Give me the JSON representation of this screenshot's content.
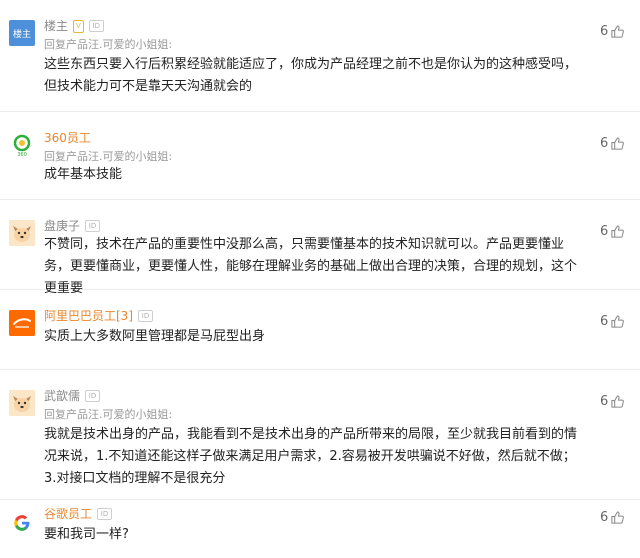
{
  "comments": [
    {
      "avatar_text": "楼主",
      "username": "楼主",
      "badge_v": "V",
      "id_tag": "ID",
      "reply_to": "回复产品汪.可爱的小姐姐:",
      "body": "这些东西只要入行后积累经验就能适应了，你成为产品经理之前不也是你认为的这种感受吗，但技术能力可不是靠天天沟通就会的",
      "likes": "6"
    },
    {
      "avatar_text": "360",
      "username": "360员工",
      "id_tag": "ID",
      "reply_to": "回复产品汪.可爱的小姐姐:",
      "body": "成年基本技能",
      "likes": "6"
    },
    {
      "username": "盘庚子",
      "id_tag": "ID",
      "body": "不赞同，技术在产品的重要性中没那么高，只需要懂基本的技术知识就可以。产品更要懂业务，更要懂商业，更要懂人性，能够在理解业务的基础上做出合理的决策，合理的规划，这个更重要",
      "likes": "6"
    },
    {
      "username": "阿里巴巴员工[3]",
      "id_tag": "ID",
      "body": "实质上大多数阿里管理都是马屁型出身",
      "likes": "6"
    },
    {
      "username": "武歆儒",
      "id_tag": "ID",
      "reply_to": "回复产品汪.可爱的小姐姐:",
      "body": "我就是技术出身的产品，我能看到不是技术出身的产品所带来的局限，至少就我目前看到的情况来说，1.不知道还能这样子做来满足用户需求，2.容易被开发哄骗说不好做，然后就不做；3.对接口文档的理解不是很充分",
      "likes": "6"
    },
    {
      "username": "谷歌员工",
      "id_tag": "ID",
      "body": "要和我司一样?",
      "likes": "6"
    }
  ],
  "colors": {
    "username_gray": "#8a8a8a",
    "username_orange": "#e8862d",
    "avatar_blue": "#4d8fd8",
    "ali_orange": "#ff6a00"
  }
}
